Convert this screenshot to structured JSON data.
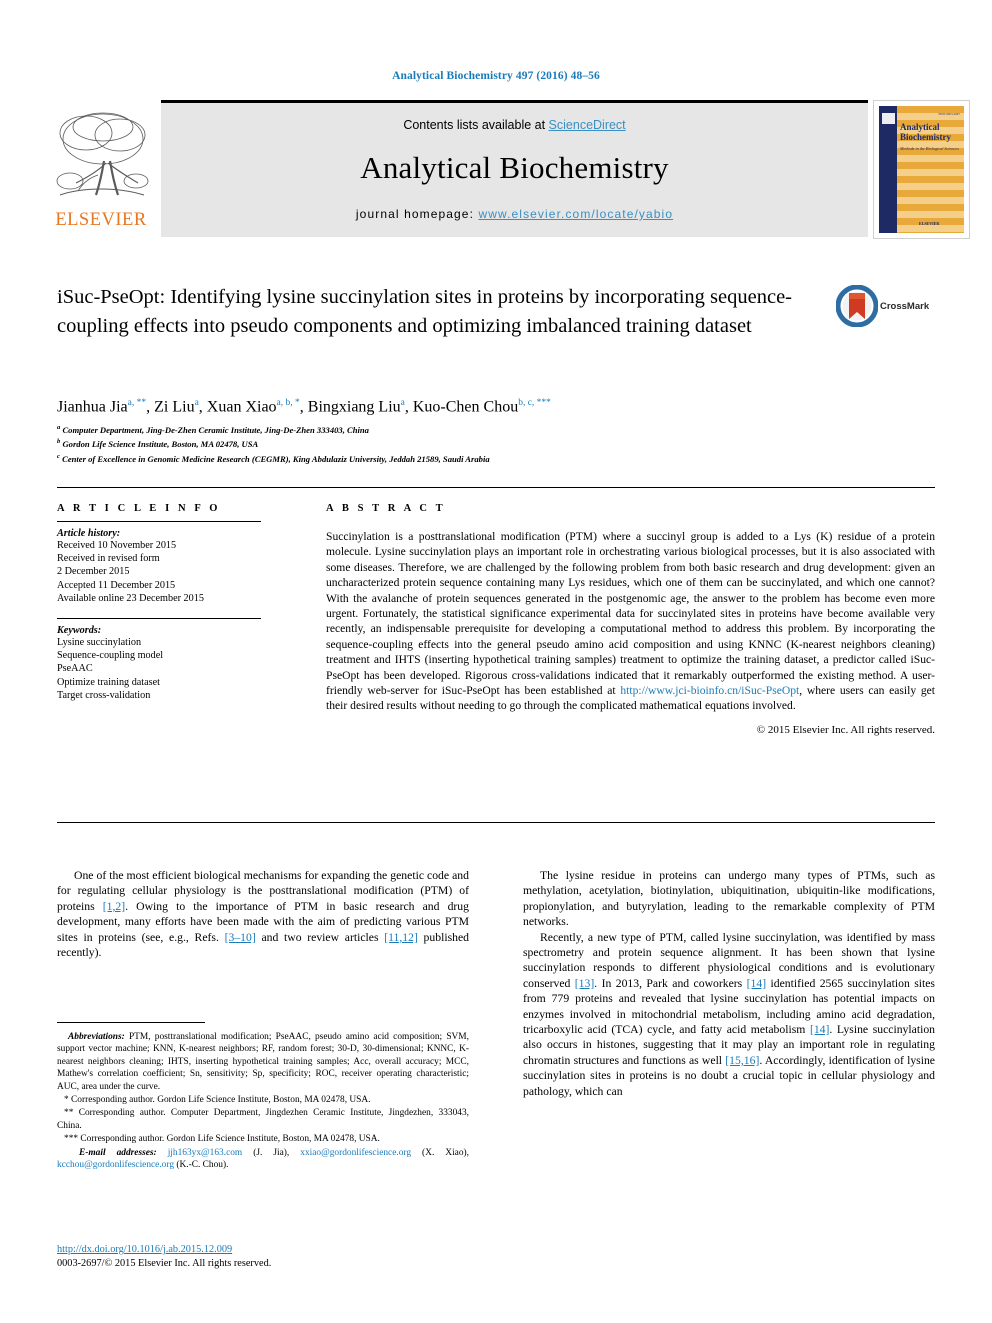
{
  "running_head": "Analytical Biochemistry 497 (2016) 48–56",
  "masthead": {
    "contents_prefix": "Contents lists available at ",
    "sciencedirect": "ScienceDirect",
    "journal_name": "Analytical Biochemistry",
    "homepage_prefix": "journal homepage: ",
    "homepage_url": "www.elsevier.com/locate/yabio",
    "publisher_logo_text": "ELSEVIER",
    "publisher_accent_color": "#e87722",
    "link_color": "#3a8fc4"
  },
  "journal_cover": {
    "title": "Analytical Biochemistry",
    "subtitle": "Methods in the Biological Sciences",
    "publisher": "ELSEVIER",
    "top_code": "ISSN 0003-2697",
    "spine_color": "#1d2a63",
    "body_color": "#e8a93a"
  },
  "article": {
    "title": "iSuc-PseOpt: Identifying lysine succinylation sites in proteins by incorporating sequence-coupling effects into pseudo components and optimizing imbalanced training dataset",
    "crossmark_label": "CrossMark",
    "authors": [
      {
        "name": "Jianhua Jia",
        "marks": "a, **"
      },
      {
        "name": "Zi Liu",
        "marks": "a"
      },
      {
        "name": "Xuan Xiao",
        "marks": "a, b, *"
      },
      {
        "name": "Bingxiang Liu",
        "marks": "a"
      },
      {
        "name": "Kuo-Chen Chou",
        "marks": "b, c, ***"
      }
    ],
    "affiliations": [
      {
        "mark": "a",
        "text": "Computer Department, Jing-De-Zhen Ceramic Institute, Jing-De-Zhen 333403, China"
      },
      {
        "mark": "b",
        "text": "Gordon Life Science Institute, Boston, MA 02478, USA"
      },
      {
        "mark": "c",
        "text": "Center of Excellence in Genomic Medicine Research (CEGMR), King Abdulaziz University, Jeddah 21589, Saudi Arabia"
      }
    ]
  },
  "article_info": {
    "heading": "A R T I C L E   I N F O",
    "history_label": "Article history:",
    "history": [
      "Received 10 November 2015",
      "Received in revised form",
      "2 December 2015",
      "Accepted 11 December 2015",
      "Available online 23 December 2015"
    ],
    "keywords_label": "Keywords:",
    "keywords": [
      "Lysine succinylation",
      "Sequence-coupling model",
      "PseAAC",
      "Optimize training dataset",
      "Target cross-validation"
    ]
  },
  "abstract": {
    "heading": "A B S T R A C T",
    "part1": "Succinylation is a posttranslational modification (PTM) where a succinyl group is added to a Lys (K) residue of a protein molecule. Lysine succinylation plays an important role in orchestrating various biological processes, but it is also associated with some diseases. Therefore, we are challenged by the following problem from both basic research and drug development: given an uncharacterized protein sequence containing many Lys residues, which one of them can be succinylated, and which one cannot? With the avalanche of protein sequences generated in the postgenomic age, the answer to the problem has become even more urgent. Fortunately, the statistical significance experimental data for succinylated sites in proteins have become available very recently, an indispensable prerequisite for developing a computational method to address this problem. By incorporating the sequence-coupling effects into the general pseudo amino acid composition and using KNNC (K-nearest neighbors cleaning) treatment and IHTS (inserting hypothetical training samples) treatment to optimize the training dataset, a predictor called iSuc-PseOpt has been developed. Rigorous cross-validations indicated that it remarkably outperformed the existing method. A user-friendly web-server for iSuc-PseOpt has been established at ",
    "url": "http://www.jci-bioinfo.cn/iSuc-PseOpt",
    "part2": ", where users can easily get their desired results without needing to go through the complicated mathematical equations involved.",
    "copyright": "© 2015 Elsevier Inc. All rights reserved."
  },
  "body": {
    "left_col": {
      "p1_a": "One of the most efficient biological mechanisms for expanding the genetic code and for regulating cellular physiology is the posttranslational modification (PTM) of proteins ",
      "p1_cite1": "[1,2]",
      "p1_b": ". Owing to the importance of PTM in basic research and drug development, many efforts have been made with the aim of predicting various PTM sites in proteins (see, e.g., Refs. ",
      "p1_cite2": "[3–10]",
      "p1_c": " and two review articles ",
      "p1_cite3": "[11,12]",
      "p1_d": " published recently)."
    },
    "right_col": {
      "p1": "The lysine residue in proteins can undergo many types of PTMs, such as methylation, acetylation, biotinylation, ubiquitination, ubiquitin-like modifications, propionylation, and butyrylation, leading to the remarkable complexity of PTM networks.",
      "p2_a": "Recently, a new type of PTM, called lysine succinylation, was identified by mass spectrometry and protein sequence alignment. It has been shown that lysine succinylation responds to different physiological conditions and is evolutionary conserved ",
      "p2_cite1": "[13]",
      "p2_b": ". In 2013, Park and coworkers ",
      "p2_cite2": "[14]",
      "p2_c": " identified 2565 succinylation sites from 779 proteins and revealed that lysine succinylation has potential impacts on enzymes involved in mitochondrial metabolism, including amino acid degradation, tricarboxylic acid (TCA) cycle, and fatty acid metabolism ",
      "p2_cite3": "[14]",
      "p2_d": ". Lysine succinylation also occurs in histones, suggesting that it may play an important role in regulating chromatin structures and functions as well ",
      "p2_cite4": "[15,16]",
      "p2_e": ". Accordingly, identification of lysine succinylation sites in proteins is no doubt a crucial topic in cellular physiology and pathology, which can"
    }
  },
  "footnotes": {
    "abbrev_label": "Abbreviations:",
    "abbrev_text": " PTM, posttranslational modification; PseAAC, pseudo amino acid composition; SVM, support vector machine; KNN, K-nearest neighbors; RF, random forest; 30-D, 30-dimensional; KNNC, K-nearest neighbors cleaning; IHTS, inserting hypothetical training samples; Acc, overall accuracy; MCC, Mathew's correlation coefficient; Sn, sensitivity; Sp, specificity; ROC, receiver operating characteristic; AUC, area under the curve.",
    "corr1_mark": "*",
    "corr1_text": " Corresponding author. Gordon Life Science Institute, Boston, MA 02478, USA.",
    "corr2_mark": "**",
    "corr2_text": " Corresponding author. Computer Department, Jingdezhen Ceramic Institute, Jingdezhen, 333043, China.",
    "corr3_mark": "***",
    "corr3_text": " Corresponding author. Gordon Life Science Institute, Boston, MA 02478, USA.",
    "email_label": "E-mail addresses:",
    "email1": "jjh163yx@163.com",
    "email1_owner": " (J. Jia), ",
    "email2": "xxiao@gordonlifescience.org",
    "email2_owner": " (X. Xiao), ",
    "email3": "kcchou@gordonlifescience.org",
    "email3_owner": " (K.-C. Chou)."
  },
  "footer": {
    "doi": "http://dx.doi.org/10.1016/j.ab.2015.12.009",
    "issn_line": "0003-2697/© 2015 Elsevier Inc. All rights reserved."
  }
}
